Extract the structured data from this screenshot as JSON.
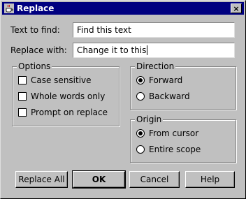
{
  "window": {
    "title": "Replace",
    "close_glyph": "×"
  },
  "fields": {
    "find_label": "Text to find:",
    "find_value": "Find this text",
    "replace_label": "Replace with:",
    "replace_value": "Change it to this"
  },
  "options": {
    "legend": "Options",
    "items": [
      {
        "label": "Case sensitive",
        "checked": false
      },
      {
        "label": "Whole words only",
        "checked": false
      },
      {
        "label": "Prompt on replace",
        "checked": false
      }
    ]
  },
  "direction": {
    "legend": "Direction",
    "items": [
      {
        "label": "Forward",
        "selected": true
      },
      {
        "label": "Backward",
        "selected": false
      }
    ]
  },
  "origin": {
    "legend": "Origin",
    "items": [
      {
        "label": "From cursor",
        "selected": true
      },
      {
        "label": "Entire scope",
        "selected": false
      }
    ]
  },
  "buttons": {
    "replace_all": "Replace All",
    "ok": "OK",
    "cancel": "Cancel",
    "help": "Help"
  },
  "icons": {
    "app": "java-cup-icon",
    "close": "close-icon"
  }
}
